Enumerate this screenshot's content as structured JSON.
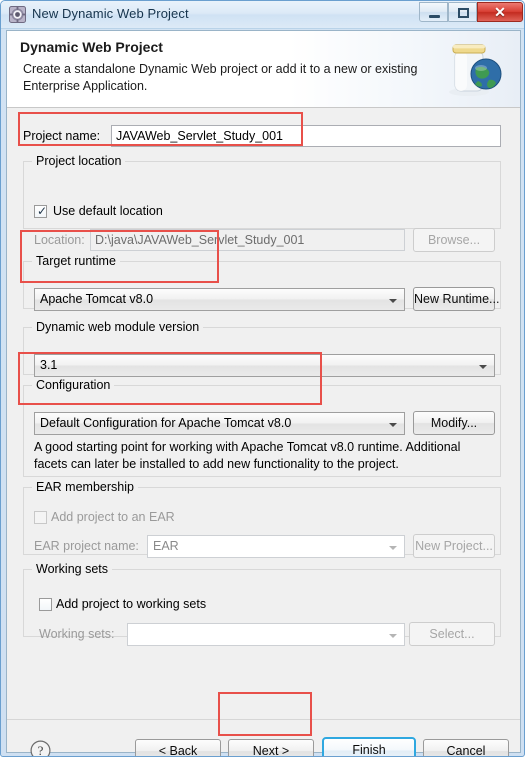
{
  "window": {
    "title": "New Dynamic Web Project",
    "icon": "gear-icon",
    "buttons": {
      "minimize": "minimize-icon",
      "maximize": "maximize-icon",
      "close": "✕"
    }
  },
  "header": {
    "title": "Dynamic Web Project",
    "description": "Create a standalone Dynamic Web project or add it to a new or existing Enterprise Application.",
    "icon": "jar-globe-icon"
  },
  "form": {
    "project_name_label": "Project name:",
    "project_name_value": "JAVAWeb_Servlet_Study_001",
    "project_location": {
      "group_title": "Project location",
      "use_default_label": "Use default location",
      "use_default_checked": true,
      "location_label": "Location:",
      "location_value": "D:\\java\\JAVAWeb_Servlet_Study_001",
      "browse_label": "Browse..."
    },
    "target_runtime": {
      "group_title": "Target runtime",
      "selected": "Apache Tomcat v8.0",
      "new_runtime_label": "New Runtime..."
    },
    "module_version": {
      "group_title": "Dynamic web module version",
      "selected": "3.1"
    },
    "configuration": {
      "group_title": "Configuration",
      "selected": "Default Configuration for Apache Tomcat v8.0",
      "modify_label": "Modify...",
      "description": "A good starting point for working with Apache Tomcat v8.0 runtime. Additional facets can later be installed to add new functionality to the project."
    },
    "ear_membership": {
      "group_title": "EAR membership",
      "add_to_ear_label": "Add project to an EAR",
      "add_to_ear_checked": false,
      "ear_project_name_label": "EAR project name:",
      "ear_project_name_value": "EAR",
      "new_project_label": "New Project..."
    },
    "working_sets": {
      "group_title": "Working sets",
      "add_to_working_sets_label": "Add project to working sets",
      "add_to_working_sets_checked": false,
      "working_sets_label": "Working sets:",
      "working_sets_value": "",
      "select_label": "Select..."
    }
  },
  "footer": {
    "help_icon": "help-icon",
    "back_label": "< Back",
    "next_label": "Next >",
    "finish_label": "Finish",
    "cancel_label": "Cancel"
  },
  "annotations": {
    "color": "#e8504a",
    "boxes": [
      "project-name",
      "target-runtime",
      "configuration",
      "next-button"
    ]
  }
}
